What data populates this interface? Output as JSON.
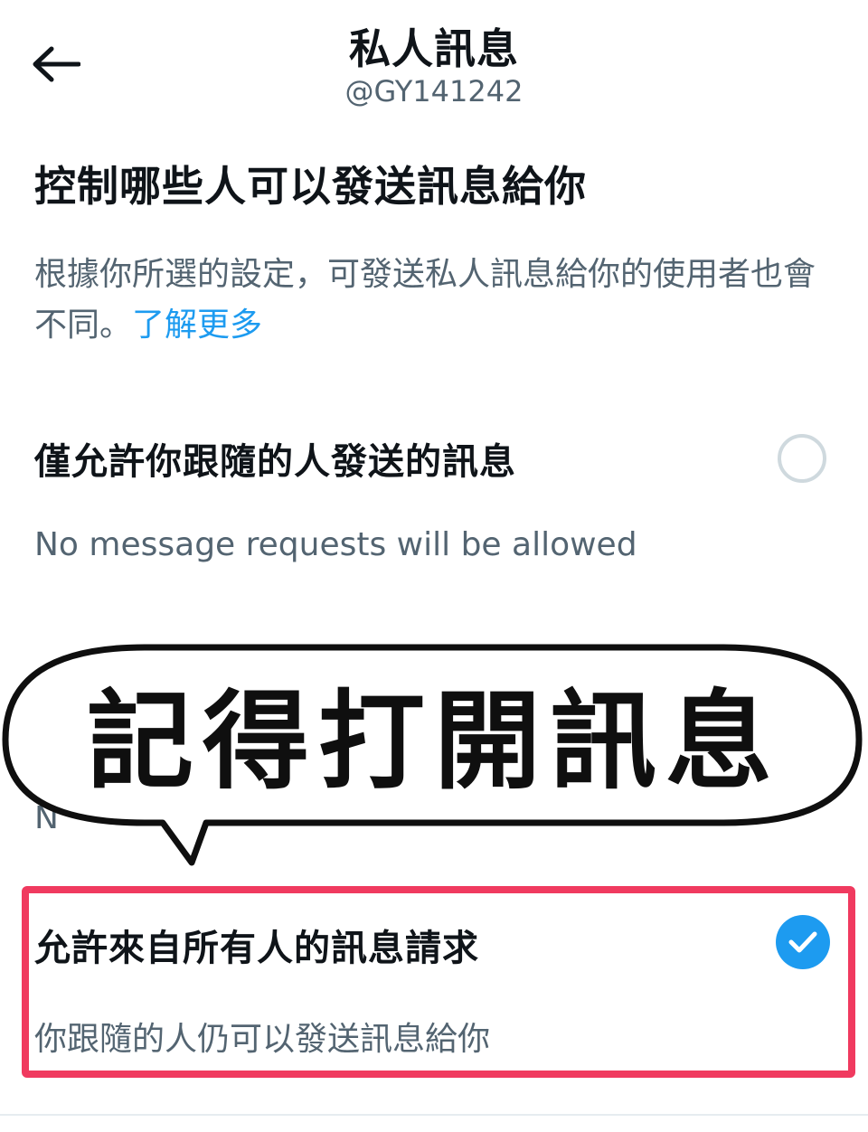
{
  "header": {
    "title": "私人訊息",
    "handle": "@GY141242"
  },
  "section": {
    "heading": "控制哪些人可以發送訊息給你",
    "description": "根據你所選的設定，可發送私人訊息給你的使用者也會不同。",
    "learn_more": "了解更多"
  },
  "options": [
    {
      "title": "僅允許你跟隨的人發送的訊息",
      "subtitle": "No message requests will be allowed",
      "selected": false
    },
    {
      "title": "允許來自所有人的訊息請求",
      "subtitle": "你跟隨的人仍可以發送訊息給你",
      "selected": true
    }
  ],
  "annotation": {
    "bubble_text": "記得打開訊息",
    "highlight_color": "#f03a5f"
  },
  "colors": {
    "accent": "#1d9bf0",
    "text_primary": "#0f1419",
    "text_secondary": "#536471",
    "radio_border": "#cfd9de"
  },
  "icons": {
    "back": "arrow-left-icon",
    "check": "check-icon"
  }
}
